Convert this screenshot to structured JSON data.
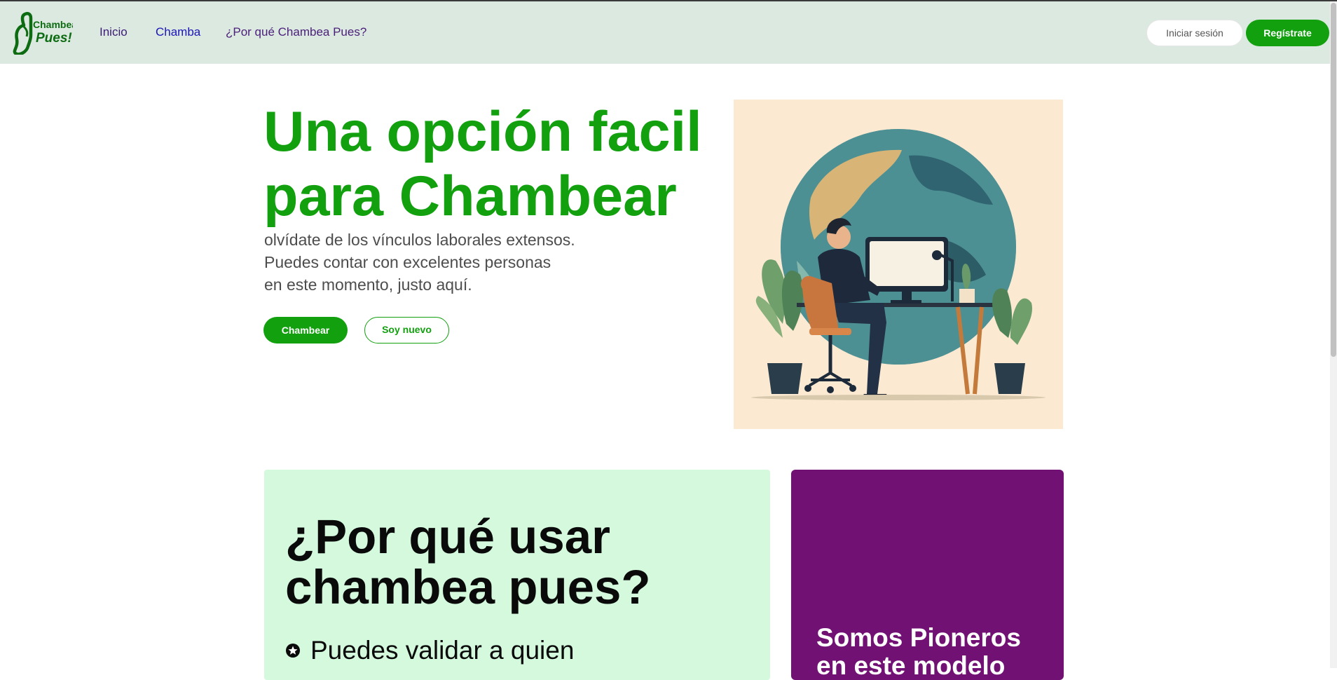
{
  "brand": {
    "logo_line1": "Chambea",
    "logo_line2": "Pues!",
    "primary_color": "#12a00f",
    "purple_color": "#721174"
  },
  "nav": {
    "links": [
      "Inicio",
      "Chamba",
      "¿Por qué Chambea Pues?"
    ],
    "login_label": "Iniciar sesión",
    "register_label": "Regístrate"
  },
  "hero": {
    "title": "Una opción facil para Chambear",
    "subtitle_lines": [
      "olvídate de los vínculos laborales extensos.",
      "Puedes contar con excelentes personas",
      "en este momento, justo aquí."
    ],
    "primary_button": "Chambear",
    "secondary_button": "Soy nuevo"
  },
  "why_card": {
    "title": "¿Por qué usar chambea pues?",
    "features": [
      "Puedes validar a quien"
    ]
  },
  "purple_card": {
    "title": "Somos Pioneros en este modelo"
  }
}
